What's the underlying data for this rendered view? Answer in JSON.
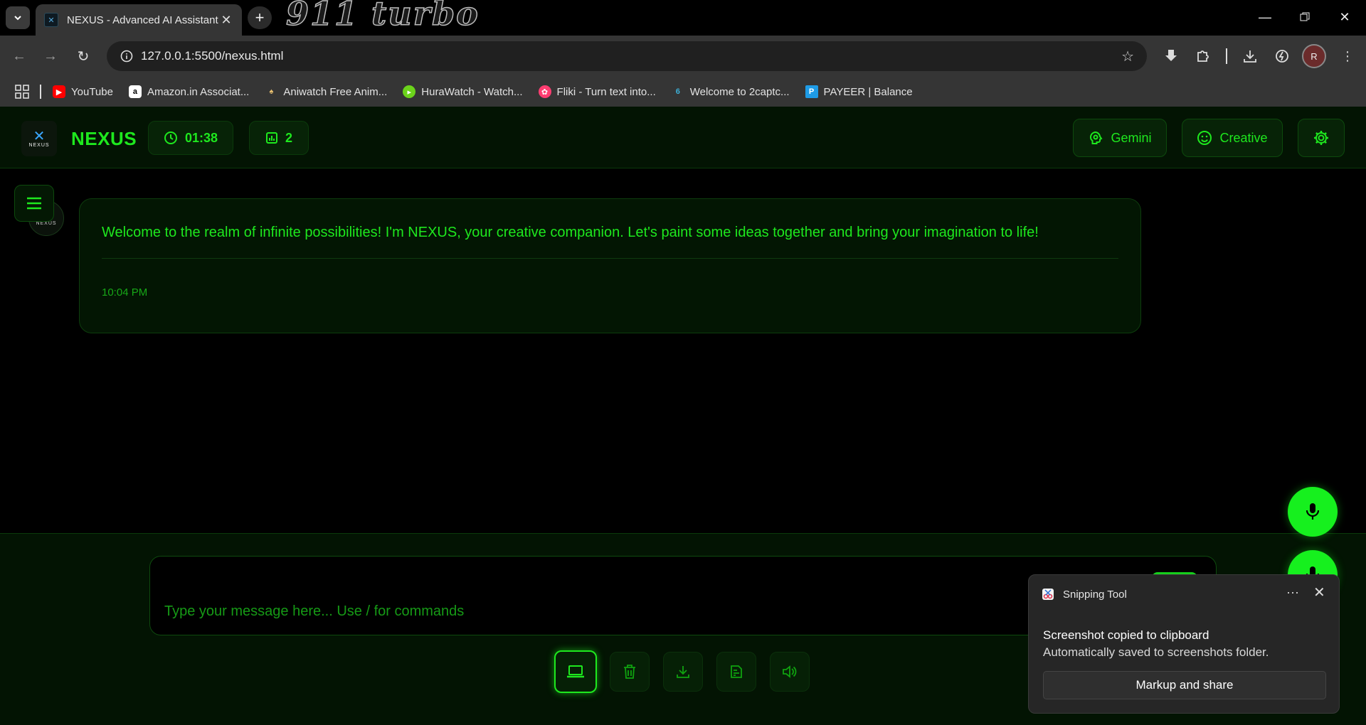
{
  "browser": {
    "tab_title": "NEXUS - Advanced AI Assistant",
    "url": "127.0.0.1:5500/nexus.html",
    "theme_logo": "911 turbo",
    "profile_initial": "R",
    "bookmarks": [
      {
        "label": "YouTube",
        "icon": "youtube-icon",
        "color": "#ff0000"
      },
      {
        "label": "Amazon.in Associat...",
        "icon": "amazon-icon",
        "color": "#ffffff"
      },
      {
        "label": "Aniwatch Free Anim...",
        "icon": "aniwatch-icon",
        "color": "#e8c070"
      },
      {
        "label": "HuraWatch - Watch...",
        "icon": "hurawatch-icon",
        "color": "#6bd31b"
      },
      {
        "label": "Fliki - Turn text into...",
        "icon": "fliki-icon",
        "color": "#ff3d71"
      },
      {
        "label": "Welcome to 2captc...",
        "icon": "2captcha-icon",
        "color": "#3db0d8"
      },
      {
        "label": "PAYEER | Balance",
        "icon": "payeer-icon",
        "color": "#1e9be6"
      }
    ]
  },
  "app": {
    "brand": "NEXUS",
    "brand_logo_text": "NEXUS",
    "timer": "01:38",
    "count": "2",
    "model_label": "Gemini",
    "mode_label": "Creative",
    "accent_color": "#1ee81e",
    "message": {
      "text": "Welcome to the realm of infinite possibilities! I'm NEXUS, your creative companion. Let's paint some ideas together and bring your imagination to life!",
      "time": "10:04 PM"
    },
    "input_placeholder": "Type your message here... Use / for commands",
    "toolbar_icons": [
      "laptop-icon",
      "trash-icon",
      "download-icon",
      "export-icon",
      "speaker-icon"
    ]
  },
  "toast": {
    "app_name": "Snipping Tool",
    "more": "···",
    "title": "Screenshot copied to clipboard",
    "body": "Automatically saved to screenshots folder.",
    "action": "Markup and share"
  }
}
